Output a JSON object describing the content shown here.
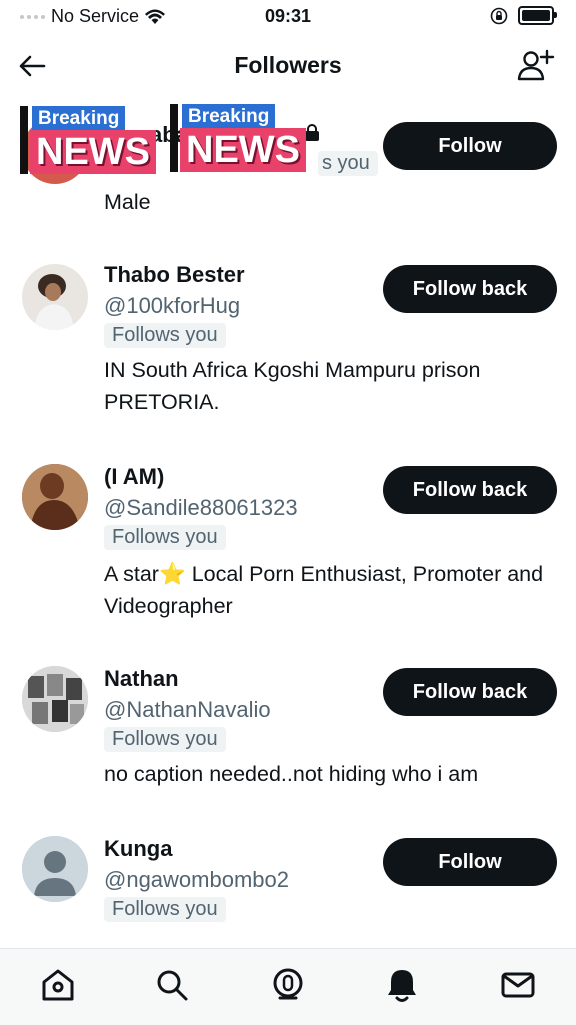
{
  "status_bar": {
    "carrier": "No Service",
    "time": "09:31"
  },
  "header": {
    "title": "Followers"
  },
  "top_row": {
    "name_fragment": "abal",
    "follows_fragment": "s you",
    "bio": "Male",
    "button": "Follow",
    "sticker_top": "Breaking",
    "sticker_bottom": "NEWS"
  },
  "users": [
    {
      "name": "Thabo Bester",
      "handle": "@100kforHug",
      "badge": "Follows you",
      "bio": "IN South Africa Kgoshi Mampuru prison PRETORIA.",
      "button": "Follow back"
    },
    {
      "name": "(I AM)",
      "handle": "@Sandile88061323",
      "badge": "Follows you",
      "bio": "A star⭐️ Local Porn Enthusiast, Promoter and Videographer",
      "button": "Follow back"
    },
    {
      "name": "Nathan",
      "handle": "@NathanNavalio",
      "badge": "Follows you",
      "bio": "no caption needed..not hiding who i am",
      "button": "Follow back"
    },
    {
      "name": "Kunga",
      "handle": "@ngawombombo2",
      "badge": "Follows you",
      "bio": "",
      "button": "Follow"
    }
  ],
  "tabs": [
    "home-icon",
    "search-icon",
    "spaces-icon",
    "notifications-icon",
    "messages-icon"
  ]
}
